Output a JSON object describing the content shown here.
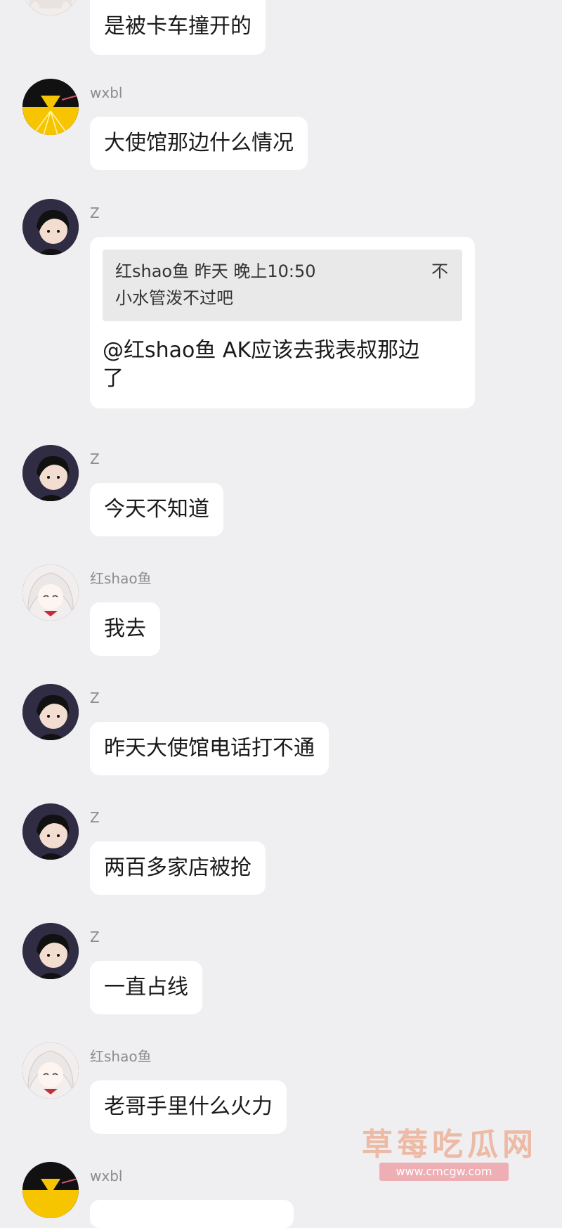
{
  "messages": [
    {
      "sender": "",
      "text": "是被卡车撞开的"
    },
    {
      "sender": "wxbl",
      "text": "大使馆那边什么情况"
    },
    {
      "sender": "Z",
      "quote": {
        "header": "红shao鱼 昨天 晚上10:50",
        "body": "小水管泼不过吧",
        "close": "不"
      },
      "text_lines": [
        "@红shao鱼 AK应该去我表叔那边",
        "了"
      ]
    },
    {
      "sender": "Z",
      "text": "今天不知道"
    },
    {
      "sender": "红shao鱼",
      "text": "我去"
    },
    {
      "sender": "Z",
      "text": "昨天大使馆电话打不通"
    },
    {
      "sender": "Z",
      "text": "两百多家店被抢"
    },
    {
      "sender": "Z",
      "text": "一直占线"
    },
    {
      "sender": "红shao鱼",
      "text": "老哥手里什么火力"
    },
    {
      "sender": "wxbl",
      "text": ""
    }
  ],
  "watermark": {
    "title": "草莓吃瓜网",
    "url": "www.cmcgw.com"
  },
  "icons": {
    "wxbl": "pizza-avatar-icon",
    "Z": "boy-avatar-icon",
    "红shao鱼": "girl-avatar-icon"
  }
}
